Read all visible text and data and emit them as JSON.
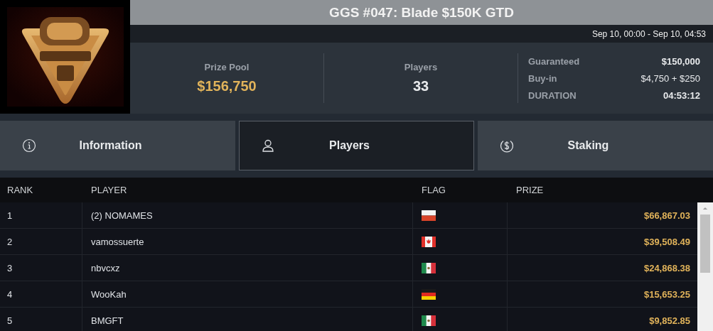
{
  "title": "GGS #047: Blade $150K GTD",
  "dates": "Sep 10, 00:00 - Sep 10, 04:53",
  "stats": [
    {
      "label": "Prize Pool",
      "value": "$156,750",
      "kind": "money"
    },
    {
      "label": "Players",
      "value": "33",
      "kind": "count"
    }
  ],
  "details": [
    {
      "label": "Guaranteed",
      "value": "$150,000",
      "bold": true
    },
    {
      "label": "Buy-in",
      "value": "$4,750 + $250",
      "bold": false
    },
    {
      "label": "DURATION",
      "value": "04:53:12",
      "bold": true
    }
  ],
  "tabs": [
    {
      "label": "Information",
      "kind": "info",
      "selected": false
    },
    {
      "label": "Players",
      "kind": "user",
      "selected": true
    },
    {
      "label": "Staking",
      "kind": "dollar",
      "selected": false
    }
  ],
  "table": {
    "columns": [
      "RANK",
      "PLAYER",
      "FLAG",
      "PRIZE"
    ],
    "rows": [
      {
        "rank": "1",
        "player": "(2) NOMAMES",
        "kind": "pl",
        "prize": "$66,867.03"
      },
      {
        "rank": "2",
        "player": "vamossuerte",
        "kind": "ca",
        "prize": "$39,508.49"
      },
      {
        "rank": "3",
        "player": "nbvcxz",
        "kind": "mx",
        "prize": "$24,868.38"
      },
      {
        "rank": "4",
        "player": "WooKah",
        "kind": "de",
        "prize": "$15,653.25"
      },
      {
        "rank": "5",
        "player": "BMGFT",
        "kind": "mx",
        "prize": "$9,852.85"
      }
    ]
  }
}
